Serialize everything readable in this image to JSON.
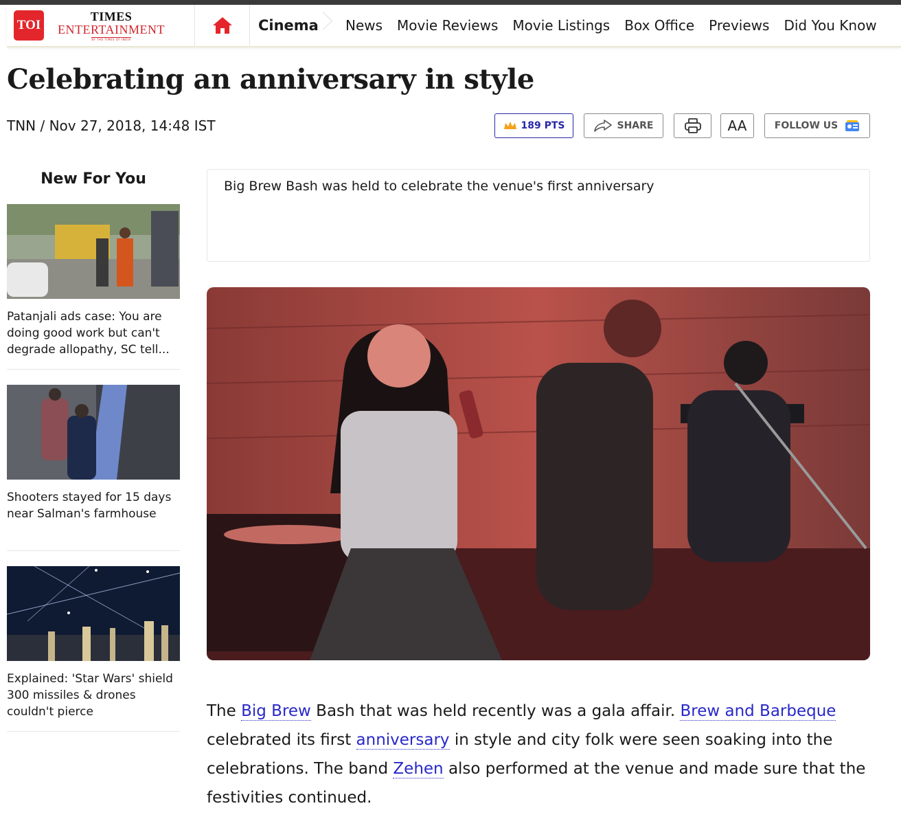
{
  "header": {
    "badge": "TOI",
    "brand_top": "TIMES",
    "brand_mid": "ENTERTAINMENT",
    "brand_sub": "BY THE TIMES OF INDIA",
    "home_icon": "home-icon",
    "section": "Cinema",
    "nav": [
      "News",
      "Movie Reviews",
      "Movie Listings",
      "Box Office",
      "Previews",
      "Did You Know"
    ]
  },
  "article": {
    "title": "Celebrating an anniversary in style",
    "byline": "TNN / Nov 27, 2018, 14:48 IST",
    "summary": "Big Brew Bash was held to celebrate the venue's first anniversary",
    "body": {
      "p1": "The ",
      "l1": "Big Brew",
      "p2": " Bash that was held recently was a gala affair. ",
      "l2": "Brew and Barbeque",
      "p3": " celebrated its first ",
      "l3": "anniversary",
      "p4": " in style and city folk were seen soaking into the celebrations. The band ",
      "l4": "Zehen",
      "p5": " also performed at the venue and made sure that the festivities continued."
    }
  },
  "actions": {
    "points": "189 PTS",
    "share": "SHARE",
    "font_size": "AA",
    "follow": "FOLLOW US"
  },
  "sidebar": {
    "title": "New For You",
    "items": [
      {
        "text": "Patanjali ads case: You are doing good work but can't degrade allopathy, SC tell..."
      },
      {
        "text": "Shooters stayed for 15 days near Salman's farmhouse"
      },
      {
        "text": "Explained: 'Star Wars' shield 300 missiles & drones couldn't pierce"
      }
    ]
  },
  "colors": {
    "brand_red": "#e3262b",
    "link_blue": "#2828c8",
    "points_blue": "#2727a8"
  }
}
